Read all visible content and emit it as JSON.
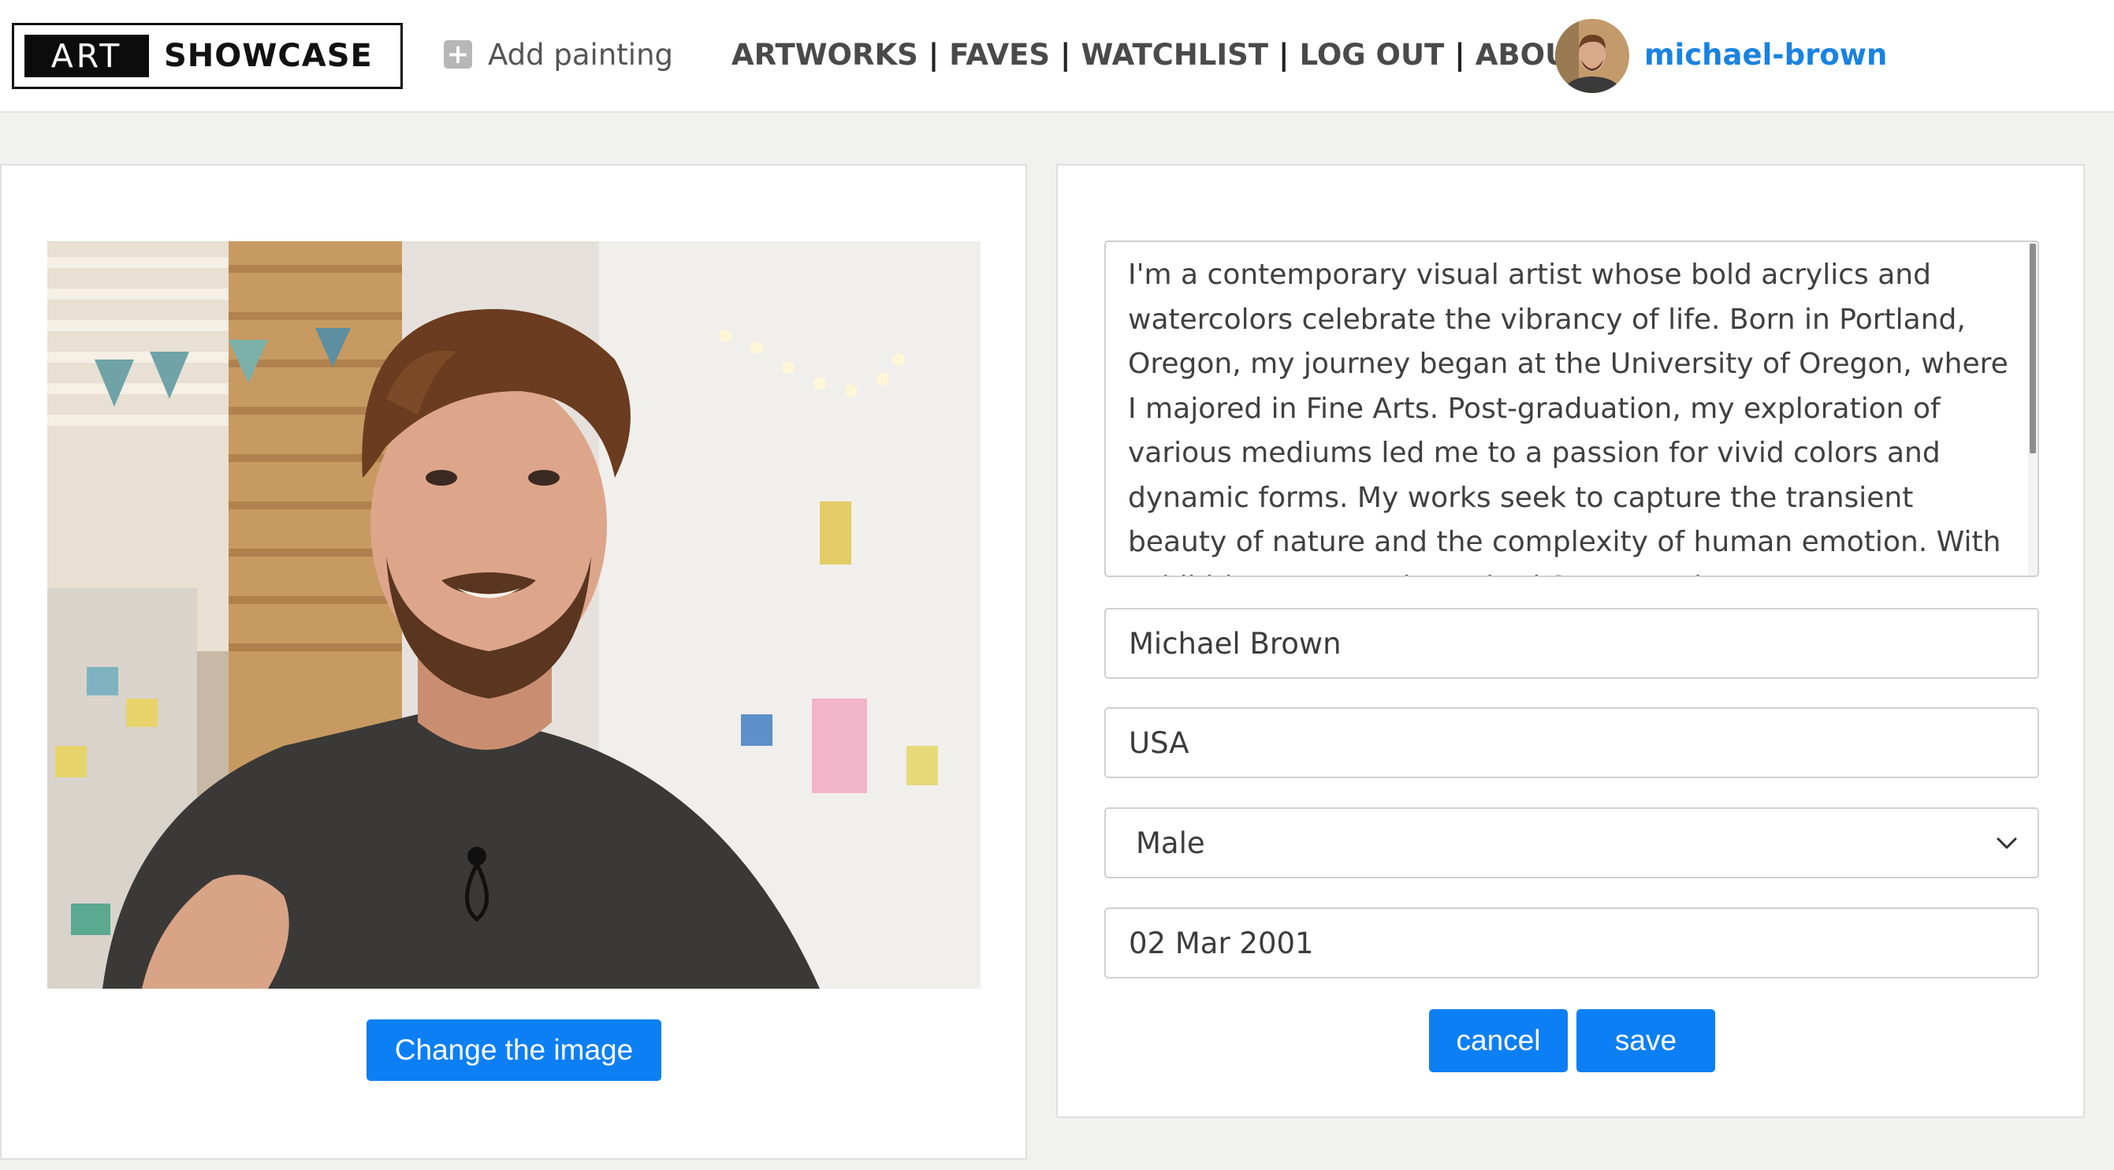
{
  "header": {
    "logo": {
      "part1": "ART",
      "part2": "SHOWCASE"
    },
    "add_painting": {
      "icon": "plus-square-icon",
      "label": "Add painting"
    },
    "nav": [
      {
        "label": "ARTWORKS"
      },
      {
        "label": "FAVES"
      },
      {
        "label": "WATCHLIST"
      },
      {
        "label": "LOG OUT"
      },
      {
        "label": "ABOUT"
      }
    ],
    "separator": "|",
    "user": {
      "username": "michael-brown"
    }
  },
  "profile_image": {
    "button_label": "Change the image"
  },
  "form": {
    "bio": "I'm a contemporary visual artist whose bold acrylics and watercolors celebrate the vibrancy of life. Born in Portland, Oregon, my journey began at the University of Oregon, where I majored in Fine Arts. Post-graduation, my exploration of various mediums led me to a passion for vivid colors and dynamic forms. My works seek to capture the transient beauty of nature and the complexity of human emotion. With exhibitions across the United States and Europe",
    "name": "Michael Brown",
    "country": "USA",
    "gender": "Male",
    "date_of_birth": "02 Mar 2001",
    "cancel_label": "cancel",
    "save_label": "save"
  },
  "colors": {
    "accent": "#0d7ff5",
    "username": "#1a82e0",
    "nav_text": "#4a4a4a"
  }
}
